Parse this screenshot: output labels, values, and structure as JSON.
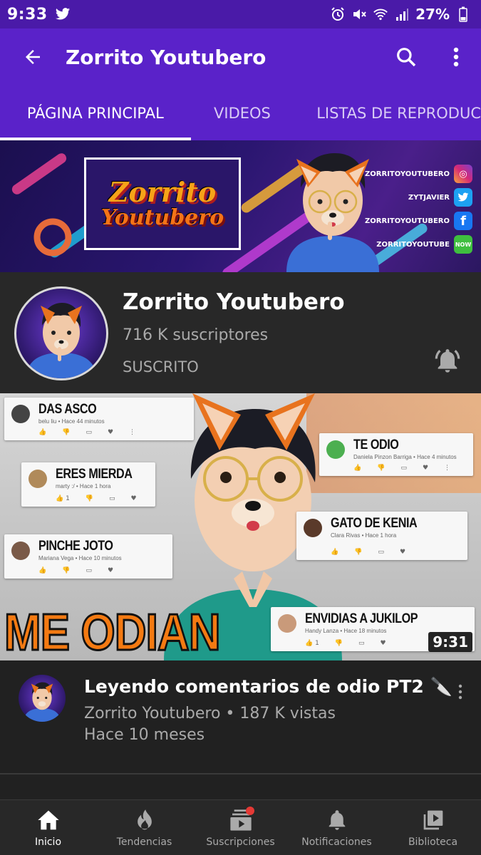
{
  "status_bar": {
    "time": "9:33",
    "battery": "27%",
    "icons": [
      "twitter-icon",
      "alarm-icon",
      "mute-icon",
      "wifi-icon",
      "signal-icon",
      "battery-icon"
    ]
  },
  "app_bar": {
    "title": "Zorrito Youtubero",
    "icons": [
      "back-arrow-icon",
      "search-icon",
      "more-vert-icon"
    ]
  },
  "tabs": [
    {
      "label": "PÁGINA PRINCIPAL",
      "active": true
    },
    {
      "label": "VIDEOS",
      "active": false
    },
    {
      "label": "LISTAS DE REPRODUC",
      "active": false
    }
  ],
  "banner": {
    "logo_line1": "Zorrito",
    "logo_line2": "Youtubero",
    "socials": [
      {
        "handle": "ZORRITOYOUTUBERO",
        "icon": "instagram-icon",
        "color": "#d62976",
        "glyph": "◎"
      },
      {
        "handle": "ZYTJAVIER",
        "icon": "twitter-icon",
        "color": "#1da1f2",
        "glyph": "t"
      },
      {
        "handle": "ZORRITOYOUTUBERO",
        "icon": "facebook-icon",
        "color": "#1877f2",
        "glyph": "f"
      },
      {
        "handle": "ZORRITOYOUTUBE",
        "icon": "now-icon",
        "color": "#3fbf3f",
        "glyph": "NOW"
      }
    ]
  },
  "channel": {
    "name": "Zorrito Youtubero",
    "subscribers": "716 K suscriptores",
    "subscribed_label": "SUSCRITO"
  },
  "thumbnail": {
    "overlay_text": "ME ODIAN",
    "duration": "9:31",
    "comments": [
      {
        "text": "DAS ASCO",
        "meta": "belu liu • Hace 44 minutos",
        "likes": ""
      },
      {
        "text": "TE ODIO",
        "meta": "Daniela Pinzon Barriga • Hace 4 minutos",
        "likes": ""
      },
      {
        "text": "ERES MIERDA",
        "meta": "marty :/ • Hace 1 hora",
        "likes": "1"
      },
      {
        "text": "GATO DE KENIA",
        "meta": "Clara Rivas • Hace 1 hora",
        "likes": ""
      },
      {
        "text": "PINCHE JOTO",
        "meta": "Mariana Vega • Hace 10 minutos",
        "likes": ""
      },
      {
        "text": "ENVIDIAS A JUKILOP",
        "meta": "Handy Lanza • Hace 18 minutos",
        "likes": "1"
      }
    ]
  },
  "video": {
    "title": "Leyendo comentarios de odio PT2 🔪",
    "meta": "Zorrito Youtubero • 187 K vistas",
    "age": "Hace 10 meses"
  },
  "bottom_nav": [
    {
      "label": "Inicio",
      "icon": "home-icon",
      "active": true
    },
    {
      "label": "Tendencias",
      "icon": "trending-flame-icon",
      "active": false
    },
    {
      "label": "Suscripciones",
      "icon": "subscriptions-icon",
      "active": false
    },
    {
      "label": "Notificaciones",
      "icon": "notifications-bell-icon",
      "active": false
    },
    {
      "label": "Biblioteca",
      "icon": "library-icon",
      "active": false
    }
  ],
  "colors": {
    "status_bar": "#4a1aa8",
    "app_bar": "#5a22c9",
    "background": "#212121",
    "channel_bg": "#282828",
    "secondary_text": "#aaaaaa",
    "overlay_orange": "#f47a12",
    "badge_red": "#e53935"
  }
}
